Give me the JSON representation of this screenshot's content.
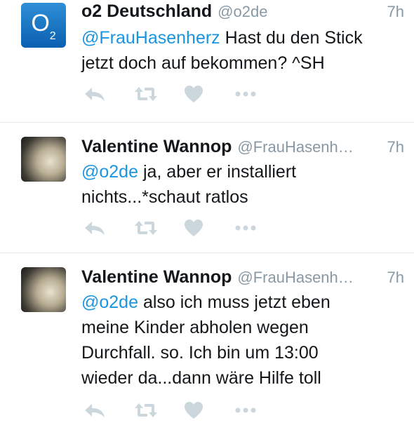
{
  "tweets": [
    {
      "name": "o2 Deutschland",
      "handle": "@o2de",
      "time": "7h",
      "mention": "@FrauHasenherz",
      "text": " Hast du den Stick jetzt doch auf bekommen? ^SH",
      "avatar": "o2-logo"
    },
    {
      "name": "Valentine Wannop",
      "handle": "@FrauHasenh…",
      "time": "7h",
      "mention": "@o2de",
      "text": " ja, aber er installiert nichts...*schaut ratlos",
      "avatar": "user-photo"
    },
    {
      "name": "Valentine Wannop",
      "handle": "@FrauHasenh…",
      "time": "7h",
      "mention": "@o2de",
      "text": " also ich muss jetzt eben meine Kinder abholen wegen Durchfall. so. Ich bin um 13:00 wieder da...dann wäre Hilfe toll",
      "avatar": "user-photo"
    }
  ],
  "avatar_text": {
    "o2_main": "O",
    "o2_sub": "2"
  },
  "icons": [
    "reply-icon",
    "retweet-icon",
    "like-icon",
    "more-icon"
  ],
  "colors": {
    "mention": "#1b95e0",
    "muted": "#8899a6",
    "icon": "#ccd6dd",
    "divider": "#e1e8ed"
  }
}
